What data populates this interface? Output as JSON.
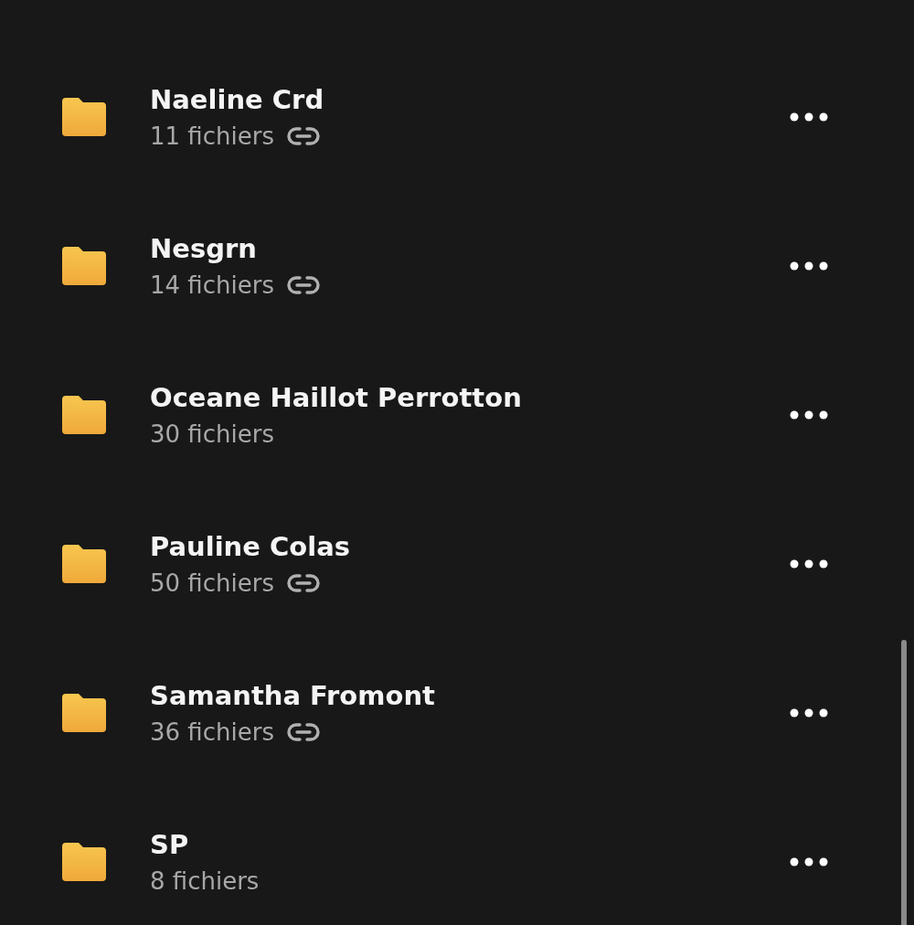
{
  "folders": [
    {
      "name": "Naeline Crd",
      "count": "11 fichiers",
      "shared": true
    },
    {
      "name": "Nesgrn",
      "count": "14 fichiers",
      "shared": true
    },
    {
      "name": "Oceane Haillot Perrotton",
      "count": "30 fichiers",
      "shared": false
    },
    {
      "name": "Pauline Colas",
      "count": "50 fichiers",
      "shared": true
    },
    {
      "name": "Samantha Fromont",
      "count": "36 fichiers",
      "shared": true
    },
    {
      "name": "SP",
      "count": "8 fichiers",
      "shared": false
    }
  ]
}
